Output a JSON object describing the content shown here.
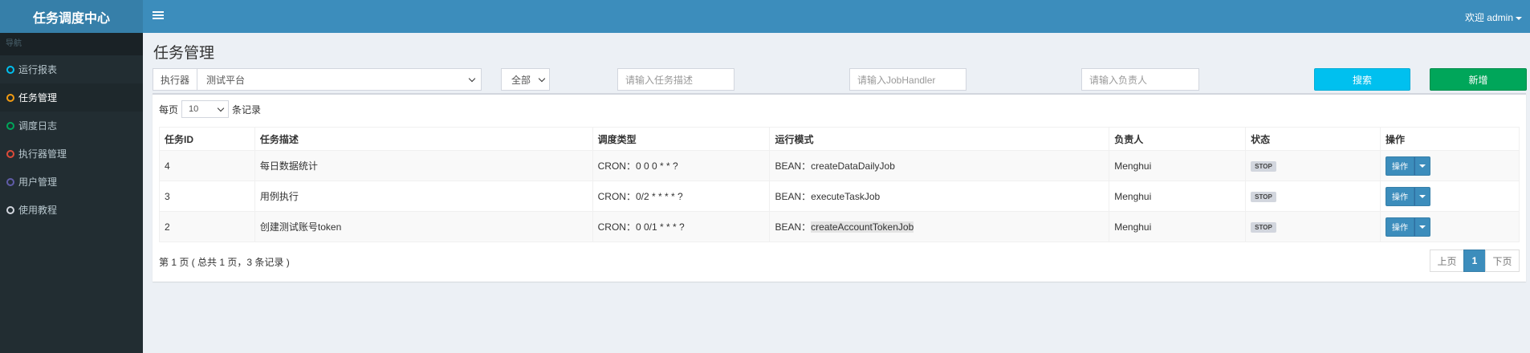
{
  "app": {
    "title": "任务调度中心"
  },
  "sidebar": {
    "header": "导航",
    "items": [
      {
        "label": "运行报表",
        "color": "#00c0ef"
      },
      {
        "label": "任务管理",
        "color": "#f39c12"
      },
      {
        "label": "调度日志",
        "color": "#00a65a"
      },
      {
        "label": "执行器管理",
        "color": "#dd4b39"
      },
      {
        "label": "用户管理",
        "color": "#605ca8"
      },
      {
        "label": "使用教程",
        "color": "#d2d6de"
      }
    ]
  },
  "topbar": {
    "user": "欢迎 admin"
  },
  "page": {
    "title": "任务管理"
  },
  "filters": {
    "executor_label": "执行器",
    "executor_value": "测试平台",
    "status_value": "全部",
    "desc_placeholder": "请输入任务描述",
    "handler_placeholder": "请输入JobHandler",
    "owner_placeholder": "请输入负责人",
    "search_label": "搜索",
    "add_label": "新增"
  },
  "table": {
    "pagesize_prefix": "每页",
    "pagesize_value": "10",
    "pagesize_suffix": "条记录",
    "columns": [
      "任务ID",
      "任务描述",
      "调度类型",
      "运行模式",
      "负责人",
      "状态",
      "操作"
    ],
    "rows": [
      {
        "id": "4",
        "desc": "每日数据统计",
        "schedule": "CRON：0 0 0 * * ?",
        "mode_prefix": "BEAN：",
        "mode_handler": "createDataDailyJob",
        "owner": "Menghui",
        "status": "STOP",
        "op": "操作"
      },
      {
        "id": "3",
        "desc": "用例执行",
        "schedule": "CRON：0/2 * * * * ?",
        "mode_prefix": "BEAN：",
        "mode_handler": "executeTaskJob",
        "owner": "Menghui",
        "status": "STOP",
        "op": "操作"
      },
      {
        "id": "2",
        "desc": "创建测试账号token",
        "schedule": "CRON：0 0/1 * * * ?",
        "mode_prefix": "BEAN：",
        "mode_handler": "createAccountTokenJob",
        "owner": "Menghui",
        "status": "STOP",
        "op": "操作"
      }
    ],
    "summary": "第 1 页 ( 总共 1 页，3 条记录 )"
  },
  "pager": {
    "prev": "上页",
    "current": "1",
    "next": "下页"
  },
  "colors": {
    "topbar": "#3c8dbc",
    "sidebar": "#222d32",
    "search_btn": "#00c0ef",
    "add_btn": "#00a65a"
  }
}
